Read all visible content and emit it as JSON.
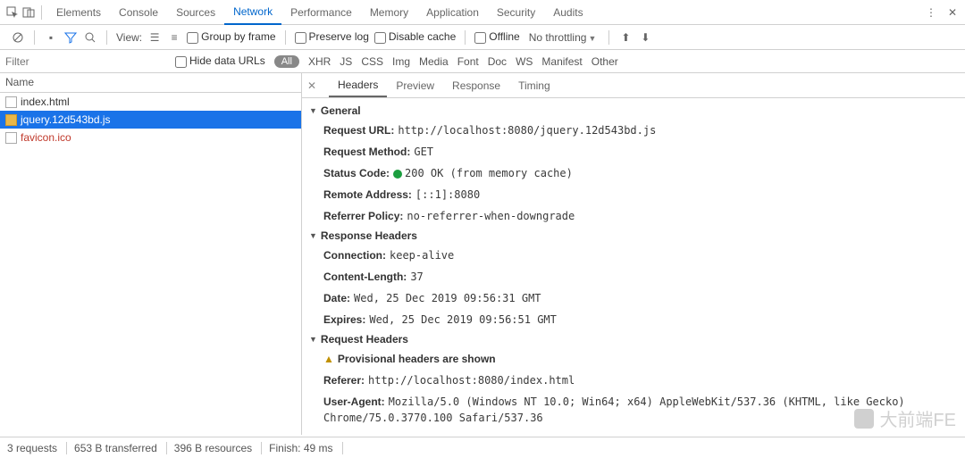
{
  "top": {
    "tabs": [
      "Elements",
      "Console",
      "Sources",
      "Network",
      "Performance",
      "Memory",
      "Application",
      "Security",
      "Audits"
    ],
    "active": 3
  },
  "toolbar": {
    "view": "View:",
    "group": "Group by frame",
    "preserve": "Preserve log",
    "disable": "Disable cache",
    "offline": "Offline",
    "throttling": "No throttling"
  },
  "filter": {
    "placeholder": "Filter",
    "hide": "Hide data URLs",
    "all": "All",
    "types": [
      "XHR",
      "JS",
      "CSS",
      "Img",
      "Media",
      "Font",
      "Doc",
      "WS",
      "Manifest",
      "Other"
    ]
  },
  "leftHead": "Name",
  "requests": [
    {
      "name": "index.html",
      "cls": ""
    },
    {
      "name": "jquery.12d543bd.js",
      "cls": "sel"
    },
    {
      "name": "favicon.ico",
      "cls": "red"
    }
  ],
  "detTabs": [
    "Headers",
    "Preview",
    "Response",
    "Timing"
  ],
  "detActive": 0,
  "sections": {
    "general": {
      "title": "General",
      "items": [
        {
          "k": "Request URL:",
          "v": "http://localhost:8080/jquery.12d543bd.js"
        },
        {
          "k": "Request Method:",
          "v": "GET"
        },
        {
          "k": "Status Code:",
          "v": "200 OK (from memory cache)",
          "status": true
        },
        {
          "k": "Remote Address:",
          "v": "[::1]:8080"
        },
        {
          "k": "Referrer Policy:",
          "v": "no-referrer-when-downgrade"
        }
      ]
    },
    "response": {
      "title": "Response Headers",
      "items": [
        {
          "k": "Connection:",
          "v": "keep-alive"
        },
        {
          "k": "Content-Length:",
          "v": "37"
        },
        {
          "k": "Date:",
          "v": "Wed, 25 Dec 2019 09:56:31 GMT"
        },
        {
          "k": "Expires:",
          "v": "Wed, 25 Dec 2019 09:56:51 GMT"
        }
      ]
    },
    "request": {
      "title": "Request Headers",
      "warn": "Provisional headers are shown",
      "items": [
        {
          "k": "Referer:",
          "v": "http://localhost:8080/index.html"
        },
        {
          "k": "User-Agent:",
          "v": "Mozilla/5.0 (Windows NT 10.0; Win64; x64) AppleWebKit/537.36 (KHTML, like Gecko) Chrome/75.0.3770.100 Safari/537.36"
        }
      ]
    }
  },
  "status": {
    "reqs": "3 requests",
    "trans": "653 B transferred",
    "res": "396 B resources",
    "finish": "Finish: 49 ms"
  },
  "watermark": "大前端FE"
}
